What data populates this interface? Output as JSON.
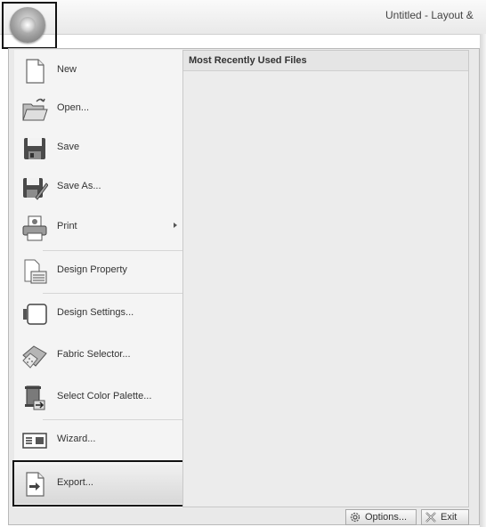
{
  "window": {
    "title": "Untitled - Layout &"
  },
  "app_button": {
    "icon": "app-menu-button-icon"
  },
  "menu": {
    "items": [
      {
        "label": "New",
        "icon": "new-file-icon"
      },
      {
        "label": "Open...",
        "icon": "open-folder-icon"
      },
      {
        "label": "Save",
        "icon": "save-disk-icon"
      },
      {
        "label": "Save As...",
        "icon": "save-as-icon"
      },
      {
        "label": "Print",
        "icon": "print-icon"
      },
      {
        "label": "Design Property",
        "icon": "design-property-icon"
      },
      {
        "label": "Design Settings...",
        "icon": "design-settings-icon"
      },
      {
        "label": "Fabric Selector...",
        "icon": "fabric-selector-icon"
      },
      {
        "label": "Select Color Palette...",
        "icon": "color-palette-icon"
      },
      {
        "label": "Wizard...",
        "icon": "wizard-icon"
      },
      {
        "label": "Export...",
        "icon": "export-icon"
      }
    ]
  },
  "recent_files": {
    "header": "Most Recently Used Files"
  },
  "footer": {
    "options_label": "Options...",
    "exit_label": "Exit"
  }
}
